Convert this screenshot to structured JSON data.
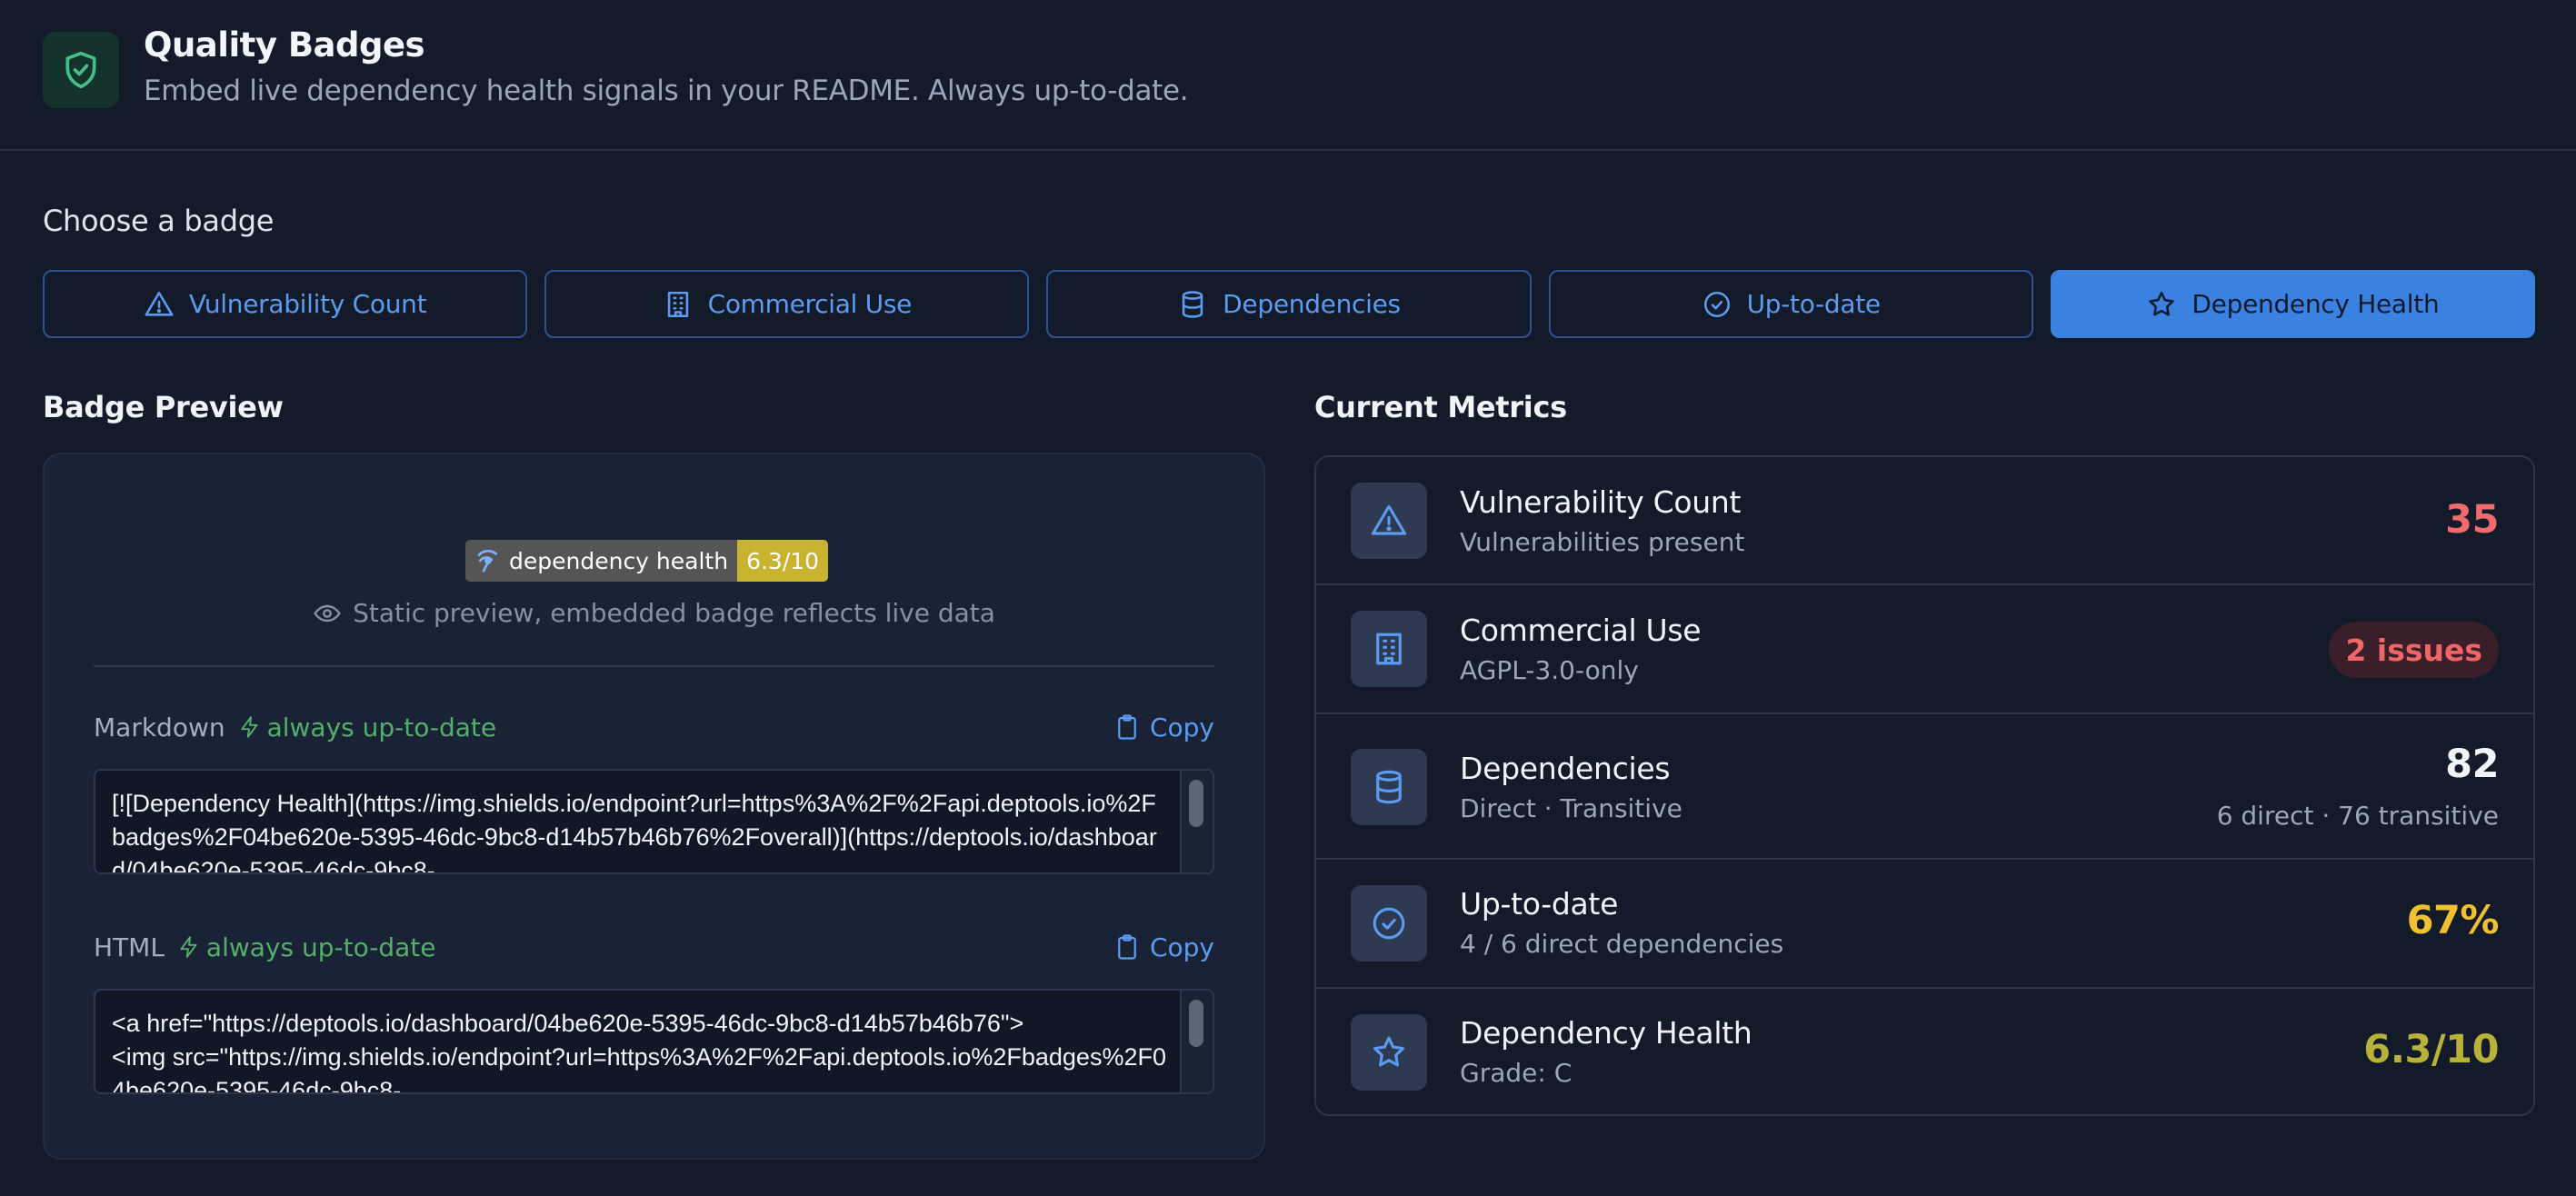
{
  "header": {
    "title": "Quality Badges",
    "subtitle": "Embed live dependency health signals in your README. Always up-to-date.",
    "logo_icon": "shield-check-icon"
  },
  "chooser": {
    "label": "Choose a badge",
    "tabs": [
      {
        "label": "Vulnerability Count",
        "icon": "warning-triangle-icon"
      },
      {
        "label": "Commercial Use",
        "icon": "building-icon"
      },
      {
        "label": "Dependencies",
        "icon": "database-icon"
      },
      {
        "label": "Up-to-date",
        "icon": "check-circle-icon"
      },
      {
        "label": "Dependency Health",
        "icon": "star-icon",
        "active": true
      }
    ]
  },
  "preview": {
    "heading": "Badge Preview",
    "badge_label": "dependency health",
    "badge_value": "6.3/10",
    "note": "Static preview, embedded badge reflects live data",
    "markdown": {
      "label": "Markdown",
      "live": "always up-to-date",
      "copy": "Copy",
      "code": "[![Dependency Health](https://img.shields.io/endpoint?url=https%3A%2F%2Fapi.deptools.io%2Fbadges%2F04be620e-5395-46dc-9bc8-d14b57b46b76%2Foverall)](https://deptools.io/dashboard/04be620e-5395-46dc-9bc8-"
    },
    "html": {
      "label": "HTML",
      "live": "always up-to-date",
      "copy": "Copy",
      "code": "<a href=\"https://deptools.io/dashboard/04be620e-5395-46dc-9bc8-d14b57b46b76\">\n<img src=\"https://img.shields.io/endpoint?url=https%3A%2F%2Fapi.deptools.io%2Fbadges%2F04be620e-5395-46dc-9bc8-"
    }
  },
  "metrics": {
    "heading": "Current Metrics",
    "items": [
      {
        "title": "Vulnerability Count",
        "sub": "Vulnerabilities present",
        "value": "35",
        "color": "#f06b6b",
        "icon": "warning-triangle-icon"
      },
      {
        "title": "Commercial Use",
        "sub": "AGPL-3.0-only",
        "value": "2 issues",
        "color": "#f06666",
        "icon": "building-icon"
      },
      {
        "title": "Dependencies",
        "sub": "Direct · Transitive",
        "value": "82",
        "note": "6 direct · 76 transitive",
        "color": "#f1f4f9",
        "icon": "database-icon"
      },
      {
        "title": "Up-to-date",
        "sub": "4 / 6 direct dependencies",
        "value": "67%",
        "color": "#f0c030",
        "icon": "check-circle-icon"
      },
      {
        "title": "Dependency Health",
        "sub": "Grade: C",
        "value": "6.3/10",
        "color": "#b8b23a",
        "icon": "star-icon"
      }
    ]
  },
  "colors": {
    "accent": "#3b82e0",
    "background": "#131b2b",
    "live_green": "#52b06a"
  }
}
